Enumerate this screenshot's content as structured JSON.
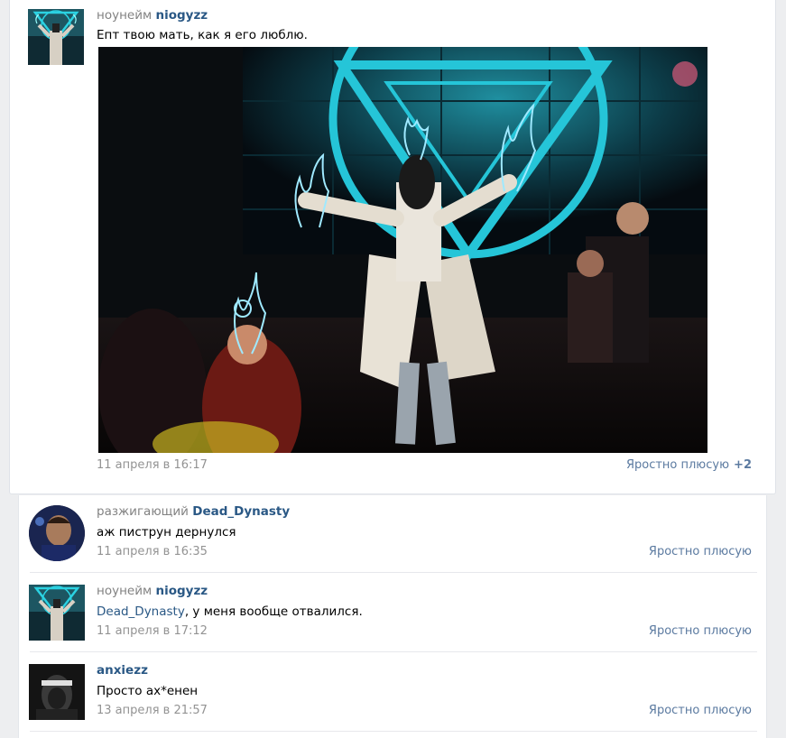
{
  "post": {
    "author": {
      "rank": "ноунейм",
      "name": "niogyzz"
    },
    "text": "Епт твою мать, как я его люблю.",
    "date": "11 апреля в 16:17",
    "like_label": "Яростно плюсую",
    "like_count": "+2"
  },
  "comments": [
    {
      "rank": "разжигающий",
      "name": "Dead_Dynasty",
      "text": "аж пиструн дернулся",
      "date": "11 апреля в 16:35",
      "like_label": "Яростно плюсую"
    },
    {
      "rank": "ноунейм",
      "name": "niogyzz",
      "mention": "Dead_Dynasty",
      "text": ", у меня вообще отвалился.",
      "date": "11 апреля в 17:12",
      "like_label": "Яростно плюсую"
    },
    {
      "rank": "",
      "name": "anxiezz",
      "text": "Просто ах*енен",
      "date": "13 апреля в 21:57",
      "like_label": "Яростно плюсую"
    }
  ],
  "colors": {
    "link": "#2a5885",
    "muted": "#939393",
    "background": "#edeef0",
    "stage_cyan": "#25c5d8"
  },
  "icons": [
    "niogyzz-avatar",
    "dead-dynasty-avatar",
    "anxiezz-avatar"
  ]
}
